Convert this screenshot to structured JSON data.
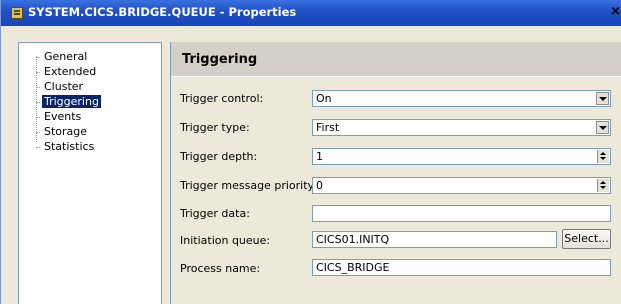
{
  "window": {
    "title": "SYSTEM.CICS.BRIDGE.QUEUE - Properties",
    "close_glyph": "×"
  },
  "tree": {
    "items": [
      {
        "label": "General",
        "selected": false
      },
      {
        "label": "Extended",
        "selected": false
      },
      {
        "label": "Cluster",
        "selected": false
      },
      {
        "label": "Triggering",
        "selected": true
      },
      {
        "label": "Events",
        "selected": false
      },
      {
        "label": "Storage",
        "selected": false
      },
      {
        "label": "Statistics",
        "selected": false
      }
    ]
  },
  "panel": {
    "title": "Triggering",
    "fields": {
      "trigger_control": {
        "label": "Trigger control:",
        "value": "On",
        "type": "dropdown"
      },
      "trigger_type": {
        "label": "Trigger type:",
        "value": "First",
        "type": "dropdown"
      },
      "trigger_depth": {
        "label": "Trigger depth:",
        "value": "1",
        "type": "spinner"
      },
      "trigger_message_priority": {
        "label": "Trigger message priority:",
        "value": "0",
        "type": "spinner"
      },
      "trigger_data": {
        "label": "Trigger data:",
        "value": "",
        "type": "text"
      },
      "initiation_queue": {
        "label": "Initiation queue:",
        "value": "CICS01.INITQ",
        "type": "text"
      },
      "process_name": {
        "label": "Process name:",
        "value": "CICS_BRIDGE",
        "type": "text"
      }
    },
    "select_button_label": "Select..."
  },
  "colors": {
    "titlebar": "#1f4fc4",
    "selection": "#0a246a",
    "panel_background": "#ece9d8",
    "header_background": "#d4d0c8"
  }
}
